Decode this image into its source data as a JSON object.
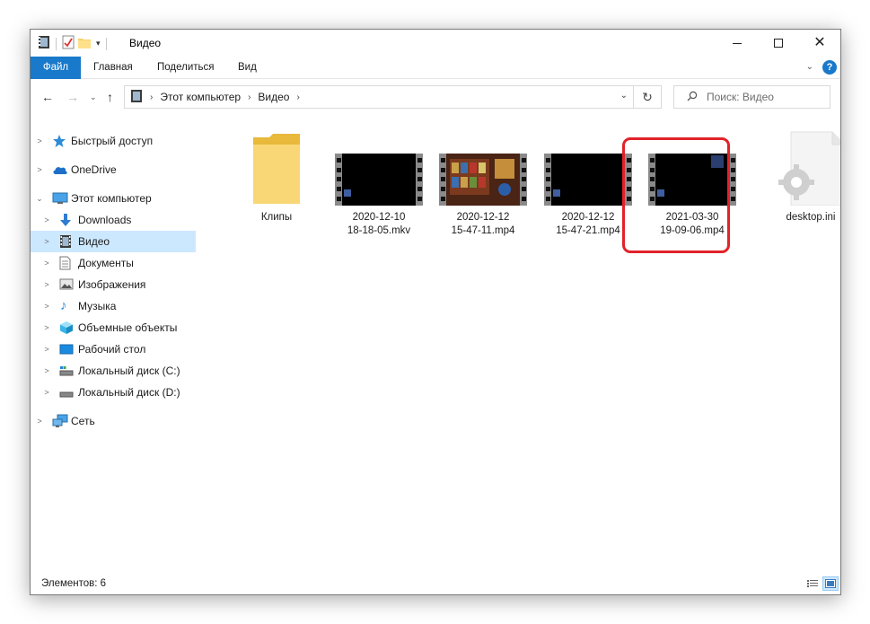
{
  "window": {
    "title": "Видео"
  },
  "ribbon": {
    "tabs": [
      "Файл",
      "Главная",
      "Поделиться",
      "Вид"
    ],
    "help": "?"
  },
  "address": {
    "crumbs": [
      "Этот компьютер",
      "Видео"
    ]
  },
  "search": {
    "placeholder": "Поиск: Видео"
  },
  "sidebar": {
    "items": [
      {
        "label": "Быстрый доступ",
        "icon": "star-icon"
      },
      {
        "label": "OneDrive",
        "icon": "cloud-icon"
      },
      {
        "label": "Этот компьютер",
        "icon": "computer-icon"
      },
      {
        "label": "Downloads",
        "icon": "download-icon"
      },
      {
        "label": "Видео",
        "icon": "video-folder-icon"
      },
      {
        "label": "Документы",
        "icon": "document-icon"
      },
      {
        "label": "Изображения",
        "icon": "picture-icon"
      },
      {
        "label": "Музыка",
        "icon": "music-icon"
      },
      {
        "label": "Объемные объекты",
        "icon": "cube-icon"
      },
      {
        "label": "Рабочий стол",
        "icon": "desktop-icon"
      },
      {
        "label": "Локальный диск (C:)",
        "icon": "drive-icon"
      },
      {
        "label": "Локальный диск (D:)",
        "icon": "drive-icon"
      },
      {
        "label": "Сеть",
        "icon": "network-icon"
      }
    ]
  },
  "files": [
    {
      "line1": "Клипы",
      "line2": "",
      "type": "folder"
    },
    {
      "line1": "2020-12-10",
      "line2": "18-18-05.mkv",
      "type": "video"
    },
    {
      "line1": "2020-12-12",
      "line2": "15-47-11.mp4",
      "type": "video"
    },
    {
      "line1": "2020-12-12",
      "line2": "15-47-21.mp4",
      "type": "video"
    },
    {
      "line1": "2021-03-30",
      "line2": "19-09-06.mp4",
      "type": "video"
    },
    {
      "line1": "desktop.ini",
      "line2": "",
      "type": "settings"
    }
  ],
  "status": {
    "text": "Элементов: 6"
  },
  "colors": {
    "accent": "#1979ca",
    "selected": "#cce8ff",
    "highlight": "#e2222a"
  }
}
